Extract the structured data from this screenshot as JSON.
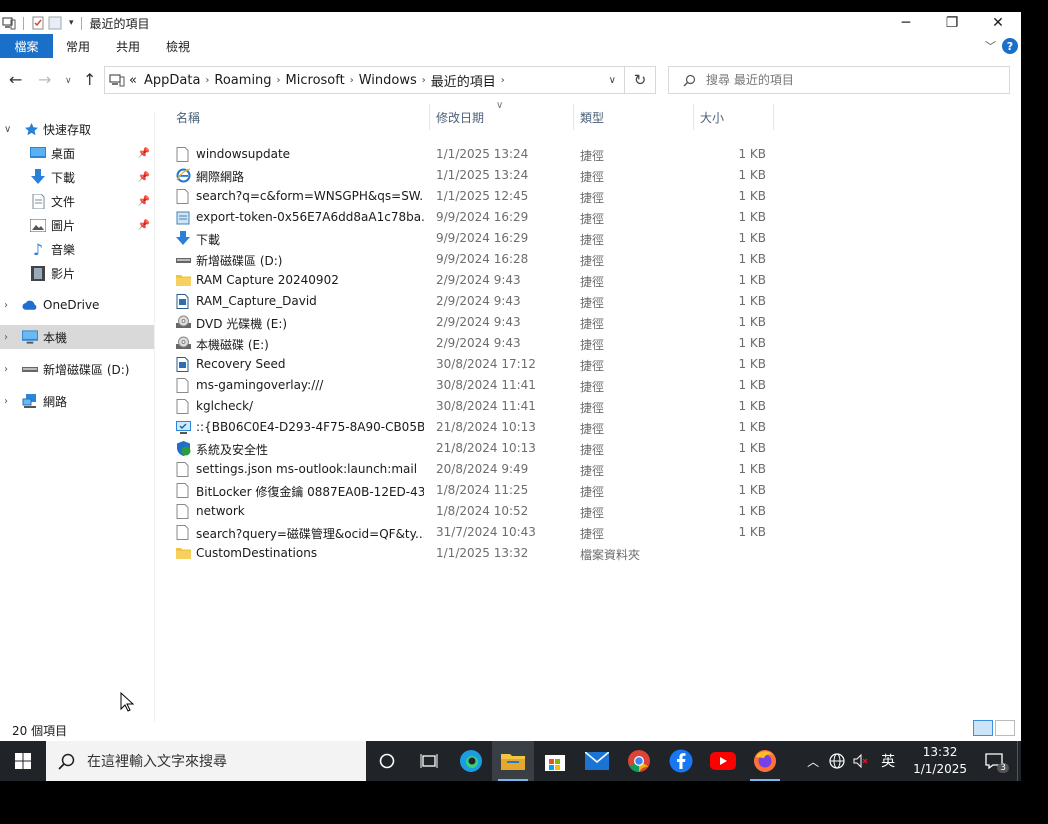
{
  "window": {
    "title": "最近的項目",
    "controls": {
      "minimize": "─",
      "maximize": "❐",
      "close": "✕"
    }
  },
  "ribbon": {
    "tabs": [
      "檔案",
      "常用",
      "共用",
      "檢視"
    ]
  },
  "address": {
    "overflow": "«",
    "breadcrumbs": [
      "AppData",
      "Roaming",
      "Microsoft",
      "Windows",
      "最近的項目"
    ],
    "search_placeholder": "搜尋 最近的項目"
  },
  "nav": {
    "quick_access": "快速存取",
    "quick_items": [
      "桌面",
      "下載",
      "文件",
      "圖片",
      "音樂",
      "影片"
    ],
    "onedrive": "OneDrive",
    "this_pc": "本機",
    "drive_d": "新增磁碟區 (D:)",
    "network": "網路"
  },
  "columns": {
    "name": "名稱",
    "date": "修改日期",
    "type": "類型",
    "size": "大小"
  },
  "files": [
    {
      "name": "windowsupdate",
      "date": "1/1/2025 13:24",
      "type": "捷徑",
      "size": "1 KB",
      "icon": "file-icon"
    },
    {
      "name": "網際網路",
      "date": "1/1/2025 13:24",
      "type": "捷徑",
      "size": "1 KB",
      "icon": "ie-icon"
    },
    {
      "name": "search?q=c&form=WNSGPH&qs=SW...",
      "date": "1/1/2025 12:45",
      "type": "捷徑",
      "size": "1 KB",
      "icon": "file-icon"
    },
    {
      "name": "export-token-0x56E7A6dd8aA1c78ba...",
      "date": "9/9/2024 16:29",
      "type": "捷徑",
      "size": "1 KB",
      "icon": "notepad-icon"
    },
    {
      "name": "下載",
      "date": "9/9/2024 16:29",
      "type": "捷徑",
      "size": "1 KB",
      "icon": "download-icon"
    },
    {
      "name": "新增磁碟區 (D:)",
      "date": "9/9/2024 16:28",
      "type": "捷徑",
      "size": "1 KB",
      "icon": "drive-icon"
    },
    {
      "name": "RAM Capture 20240902",
      "date": "2/9/2024 9:43",
      "type": "捷徑",
      "size": "1 KB",
      "icon": "folder-icon"
    },
    {
      "name": "RAM_Capture_David",
      "date": "2/9/2024 9:43",
      "type": "捷徑",
      "size": "1 KB",
      "icon": "doc-icon"
    },
    {
      "name": "DVD 光碟機 (E:)",
      "date": "2/9/2024 9:43",
      "type": "捷徑",
      "size": "1 KB",
      "icon": "dvd-icon"
    },
    {
      "name": "本機磁碟 (E:)",
      "date": "2/9/2024 9:43",
      "type": "捷徑",
      "size": "1 KB",
      "icon": "dvd-icon"
    },
    {
      "name": "Recovery Seed",
      "date": "30/8/2024 17:12",
      "type": "捷徑",
      "size": "1 KB",
      "icon": "doc-icon"
    },
    {
      "name": "ms-gamingoverlay:///",
      "date": "30/8/2024 11:41",
      "type": "捷徑",
      "size": "1 KB",
      "icon": "file-icon"
    },
    {
      "name": "kglcheck/",
      "date": "30/8/2024 11:41",
      "type": "捷徑",
      "size": "1 KB",
      "icon": "file-icon"
    },
    {
      "name": "::{BB06C0E4-D293-4F75-8A90-CB05B6...",
      "date": "21/8/2024 10:13",
      "type": "捷徑",
      "size": "1 KB",
      "icon": "monitor-check-icon"
    },
    {
      "name": "系統及安全性",
      "date": "21/8/2024 10:13",
      "type": "捷徑",
      "size": "1 KB",
      "icon": "shield-icon"
    },
    {
      "name": "settings.json ms-outlook:launch:mail",
      "date": "20/8/2024 9:49",
      "type": "捷徑",
      "size": "1 KB",
      "icon": "file-icon"
    },
    {
      "name": "BitLocker 修復金鑰 0887EA0B-12ED-43...",
      "date": "1/8/2024 11:25",
      "type": "捷徑",
      "size": "1 KB",
      "icon": "file-icon"
    },
    {
      "name": "network",
      "date": "1/8/2024 10:52",
      "type": "捷徑",
      "size": "1 KB",
      "icon": "file-icon"
    },
    {
      "name": "search?query=磁碟管理&ocid=QF&ty...",
      "date": "31/7/2024 10:43",
      "type": "捷徑",
      "size": "1 KB",
      "icon": "file-icon"
    },
    {
      "name": "CustomDestinations",
      "date": "1/1/2025 13:32",
      "type": "檔案資料夾",
      "size": "",
      "icon": "folder-icon"
    }
  ],
  "status": {
    "count": "20 個項目"
  },
  "taskbar": {
    "search_placeholder": "在這裡輸入文字來搜尋",
    "ime": "英",
    "time": "13:32",
    "date": "1/1/2025",
    "notifications": "3"
  }
}
